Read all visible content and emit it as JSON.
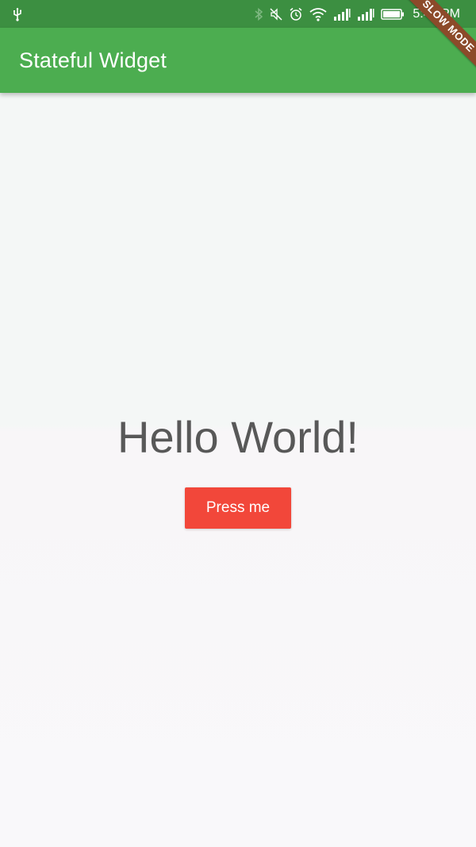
{
  "status_bar": {
    "time": "5:48 PM",
    "left_icons": [
      "usb-icon"
    ],
    "right_icons": [
      "bluetooth-icon",
      "mute-icon",
      "alarm-icon",
      "wifi-icon",
      "signal-icon",
      "signal-icon",
      "battery-icon"
    ]
  },
  "app_bar": {
    "title": "Stateful Widget",
    "color": "#4cad50"
  },
  "main": {
    "text": "Hello World!",
    "button_label": "Press me",
    "button_color": "#f2473a"
  },
  "debug_banner": {
    "label": "SLOW MODE"
  }
}
